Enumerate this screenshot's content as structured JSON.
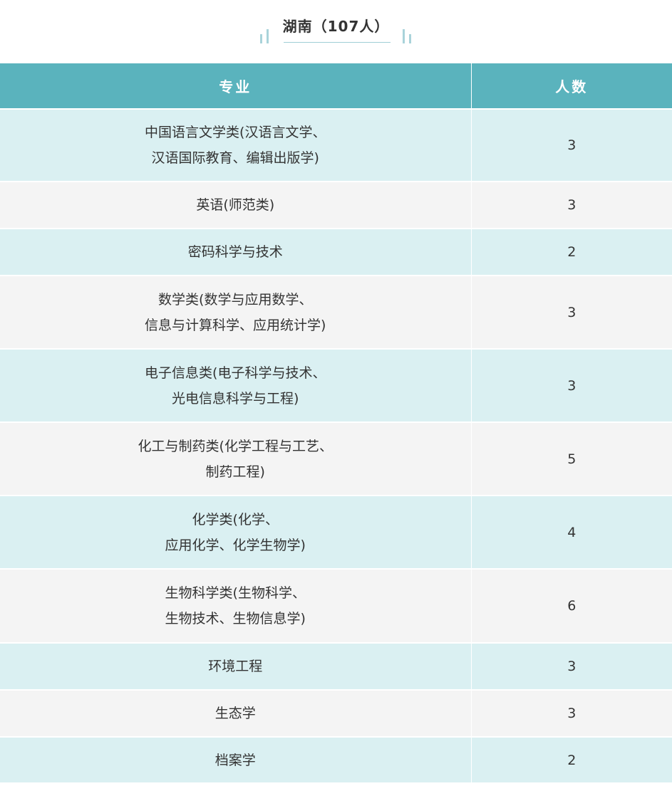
{
  "title": "湖南（107人）",
  "colors": {
    "header_bg": "#5ab3bd",
    "row_odd": "#daf0f2",
    "row_even": "#f4f4f4",
    "accent": "#a9d3da"
  },
  "table": {
    "headers": [
      "专业",
      "人数"
    ],
    "rows": [
      {
        "major": [
          "中国语言文学类(汉语言文学、",
          "汉语国际教育、编辑出版学)"
        ],
        "count": "3"
      },
      {
        "major": [
          "英语(师范类)"
        ],
        "count": "3"
      },
      {
        "major": [
          "密码科学与技术"
        ],
        "count": "2"
      },
      {
        "major": [
          "数学类(数学与应用数学、",
          "信息与计算科学、应用统计学)"
        ],
        "count": "3"
      },
      {
        "major": [
          "电子信息类(电子科学与技术、",
          "光电信息科学与工程)"
        ],
        "count": "3"
      },
      {
        "major": [
          "化工与制药类(化学工程与工艺、",
          "制药工程)"
        ],
        "count": "5"
      },
      {
        "major": [
          "化学类(化学、",
          "应用化学、化学生物学)"
        ],
        "count": "4"
      },
      {
        "major": [
          "生物科学类(生物科学、",
          "生物技术、生物信息学)"
        ],
        "count": "6"
      },
      {
        "major": [
          "环境工程"
        ],
        "count": "3"
      },
      {
        "major": [
          "生态学"
        ],
        "count": "3"
      },
      {
        "major": [
          "档案学"
        ],
        "count": "2"
      }
    ]
  }
}
